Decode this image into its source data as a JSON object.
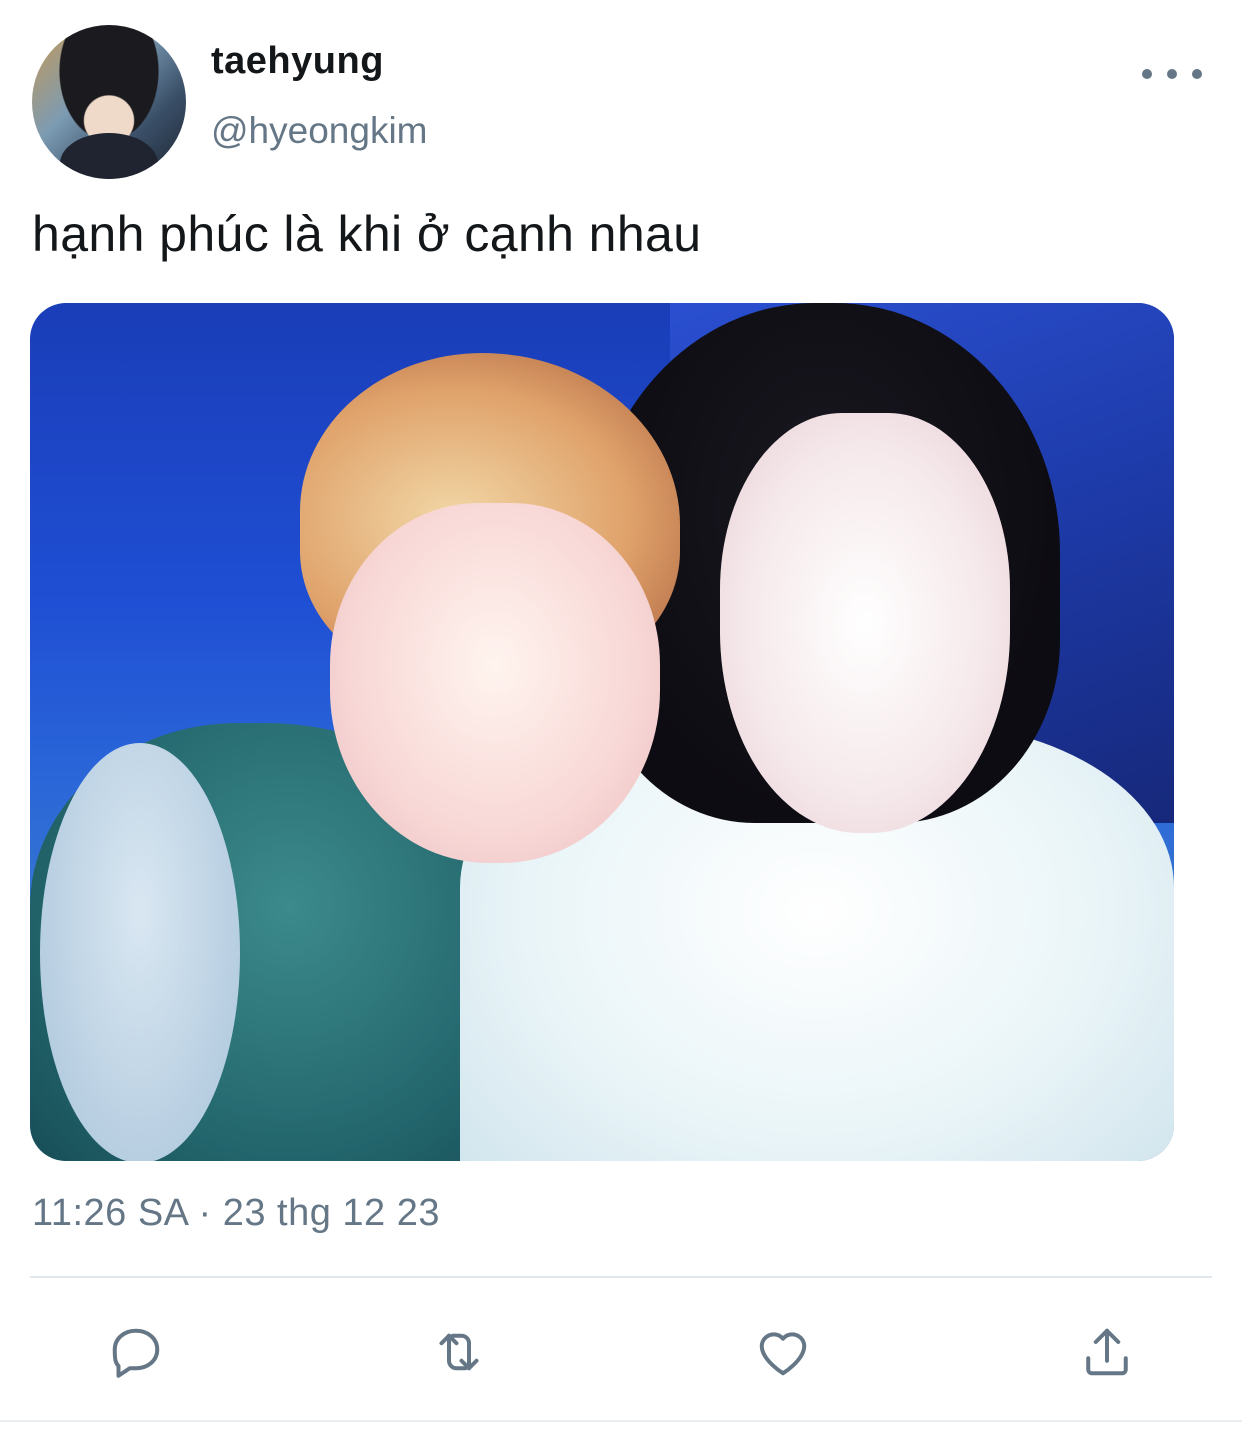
{
  "tweet": {
    "author": {
      "display_name": "taehyung",
      "handle": "@hyeongkim"
    },
    "text": "hạnh phúc là khi ở cạnh nhau",
    "timestamp": "11:26 SA · 23 thg 12 23"
  },
  "icons": {
    "more": "more-horizontal-icon",
    "reply": "reply-icon",
    "retweet": "retweet-icon",
    "like": "heart-icon",
    "share": "share-icon"
  },
  "colors": {
    "text_primary": "#14171a",
    "text_secondary": "#657786",
    "divider": "#e1e8ed"
  }
}
